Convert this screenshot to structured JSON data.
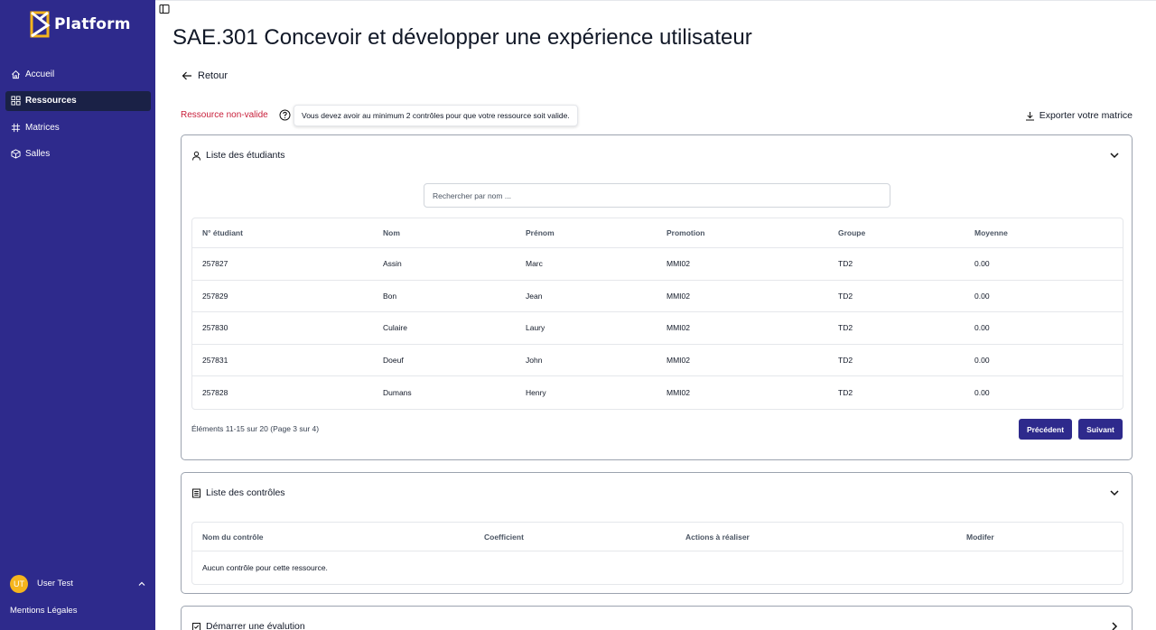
{
  "app": {
    "name": "Platform"
  },
  "sidebar": {
    "items": [
      {
        "label": "Accueil",
        "icon": "home-icon"
      },
      {
        "label": "Ressources",
        "icon": "grid-icon",
        "active": true
      },
      {
        "label": "Matrices",
        "icon": "hash-icon"
      },
      {
        "label": "Salles",
        "icon": "box-icon"
      }
    ],
    "user": {
      "initials": "UT",
      "name": "User Test"
    },
    "legal": "Mentions Légales"
  },
  "page": {
    "title": "SAE.301 Concevoir et développer une expérience utilisateur",
    "back": "Retour",
    "status": "Ressource non-valide",
    "tooltip": "Vous devez avoir au minimum 2 contrôles pour que votre ressource soit valide.",
    "export": "Exporter votre matrice"
  },
  "students": {
    "title": "Liste des étudiants",
    "search_placeholder": "Rechercher par nom ...",
    "columns": [
      "N° étudiant",
      "Nom",
      "Prénom",
      "Promotion",
      "Groupe",
      "Moyenne"
    ],
    "rows": [
      [
        "257827",
        "Assin",
        "Marc",
        "MMI02",
        "TD2",
        "0.00"
      ],
      [
        "257829",
        "Bon",
        "Jean",
        "MMI02",
        "TD2",
        "0.00"
      ],
      [
        "257830",
        "Culaire",
        "Laury",
        "MMI02",
        "TD2",
        "0.00"
      ],
      [
        "257831",
        "Doeuf",
        "John",
        "MMI02",
        "TD2",
        "0.00"
      ],
      [
        "257828",
        "Dumans",
        "Henry",
        "MMI02",
        "TD2",
        "0.00"
      ]
    ],
    "pagination": "Éléments 11-15 sur 20 (Page 3 sur 4)",
    "prev": "Précédent",
    "next": "Suivant"
  },
  "controls": {
    "title": "Liste des contrôles",
    "columns": [
      "Nom du contrôle",
      "Coefficient",
      "Actions à réaliser",
      "Modifer"
    ],
    "empty": "Aucun contrôle pour cette ressource."
  },
  "evaluation": {
    "title": "Démarrer une évalution"
  },
  "colors": {
    "brand": "#2e2a8c",
    "accent": "#f6b51d",
    "error": "#c81e3a"
  }
}
